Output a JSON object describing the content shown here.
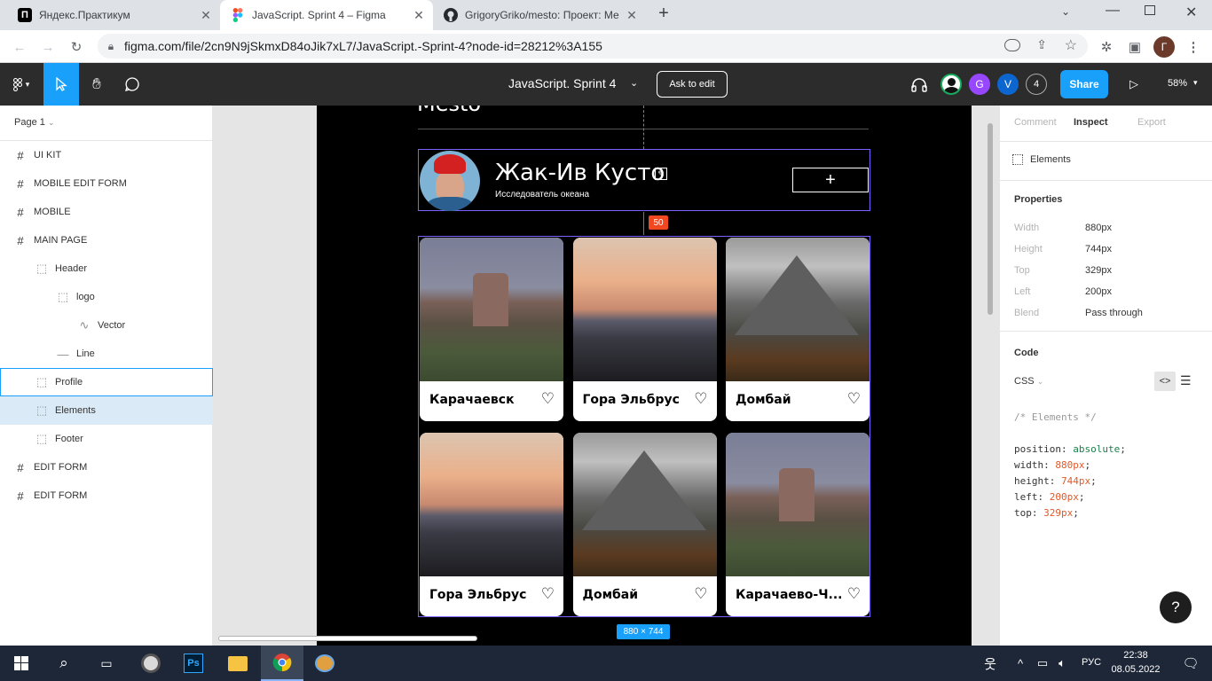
{
  "browser": {
    "tabs": [
      {
        "title": "Яндекс.Практикум",
        "favicon": "П",
        "active": false
      },
      {
        "title": "JavaScript. Sprint 4 – Figma",
        "favicon": "F",
        "active": true
      },
      {
        "title": "GrigoryGriko/mesto: Проект: Ме",
        "favicon": "gh",
        "active": false
      }
    ],
    "new_tab": "+",
    "url": "figma.com/file/2cn9N9jSkmxD84oJik7xL7/JavaScript.-Sprint-4?node-id=28212%3A155",
    "profile_initial": "Г"
  },
  "figma": {
    "file_title": "JavaScript. Sprint 4",
    "ask_to_edit": "Ask to edit",
    "avatars": [
      "G",
      "V"
    ],
    "viewer_count": "4",
    "share": "Share",
    "zoom": "58%"
  },
  "layers": {
    "page": "Page 1",
    "items": [
      {
        "name": "UI KIT",
        "icon": "frame-hash-icon",
        "indent": 0,
        "state": ""
      },
      {
        "name": "MOBILE EDIT FORM",
        "icon": "frame-hash-icon",
        "indent": 0,
        "state": ""
      },
      {
        "name": "MOBILE",
        "icon": "frame-hash-icon",
        "indent": 0,
        "state": ""
      },
      {
        "name": "MAIN PAGE",
        "icon": "frame-hash-icon",
        "indent": 0,
        "state": ""
      },
      {
        "name": "Header",
        "icon": "dotted-frame-icon",
        "indent": 1,
        "state": ""
      },
      {
        "name": "logo",
        "icon": "dotted-frame-icon",
        "indent": 2,
        "state": ""
      },
      {
        "name": "Vector",
        "icon": "vector-icon",
        "indent": 3,
        "state": ""
      },
      {
        "name": "Line",
        "icon": "line-icon",
        "indent": 2,
        "state": ""
      },
      {
        "name": "Profile",
        "icon": "dotted-frame-icon",
        "indent": 1,
        "state": "hover"
      },
      {
        "name": "Elements",
        "icon": "dotted-frame-icon",
        "indent": 1,
        "state": "selected"
      },
      {
        "name": "Footer",
        "icon": "dotted-frame-icon",
        "indent": 1,
        "state": ""
      },
      {
        "name": "EDIT FORM",
        "icon": "frame-hash-icon",
        "indent": 0,
        "state": ""
      },
      {
        "name": "EDIT FORM",
        "icon": "frame-hash-icon",
        "indent": 0,
        "state": ""
      }
    ]
  },
  "canvas": {
    "header_text": "Mesto",
    "profile_name": "Жак-Ив Кусто",
    "profile_about": "Исследователь океана",
    "add_button": "+",
    "spacing_label": "50",
    "size_label": "880 × 744",
    "cards": [
      {
        "title": "Карачаевск",
        "scene": "church"
      },
      {
        "title": "Гора Эльбрус",
        "scene": "sunset"
      },
      {
        "title": "Домбай",
        "scene": "mountain"
      },
      {
        "title": "Гора Эльбрус",
        "scene": "sunset"
      },
      {
        "title": "Домбай",
        "scene": "mountain"
      },
      {
        "title": "Карачаево-Ч...",
        "scene": "church"
      }
    ]
  },
  "inspect": {
    "tabs": [
      "Comment",
      "Inspect",
      "Export"
    ],
    "active_tab": "Inspect",
    "element": "Elements",
    "properties_title": "Properties",
    "properties": [
      {
        "key": "Width",
        "value": "880px"
      },
      {
        "key": "Height",
        "value": "744px"
      },
      {
        "key": "Top",
        "value": "329px"
      },
      {
        "key": "Left",
        "value": "200px"
      },
      {
        "key": "Blend",
        "value": "Pass through"
      }
    ],
    "code_title": "Code",
    "code_lang": "CSS",
    "code_comment": "/* Elements */",
    "code_lines": [
      {
        "prop": "position",
        "value": "absolute"
      },
      {
        "prop": "width",
        "value": "880px"
      },
      {
        "prop": "height",
        "value": "744px"
      },
      {
        "prop": "left",
        "value": "200px"
      },
      {
        "prop": "top",
        "value": "329px"
      }
    ],
    "help": "?"
  },
  "taskbar": {
    "lang": "РУС",
    "time": "22:38",
    "date": "08.05.2022"
  },
  "colors": {
    "figma_dark": "#2c2c2c",
    "figma_blue": "#18a0fb",
    "selection": "#daebf7",
    "measure_red": "#f24822"
  }
}
